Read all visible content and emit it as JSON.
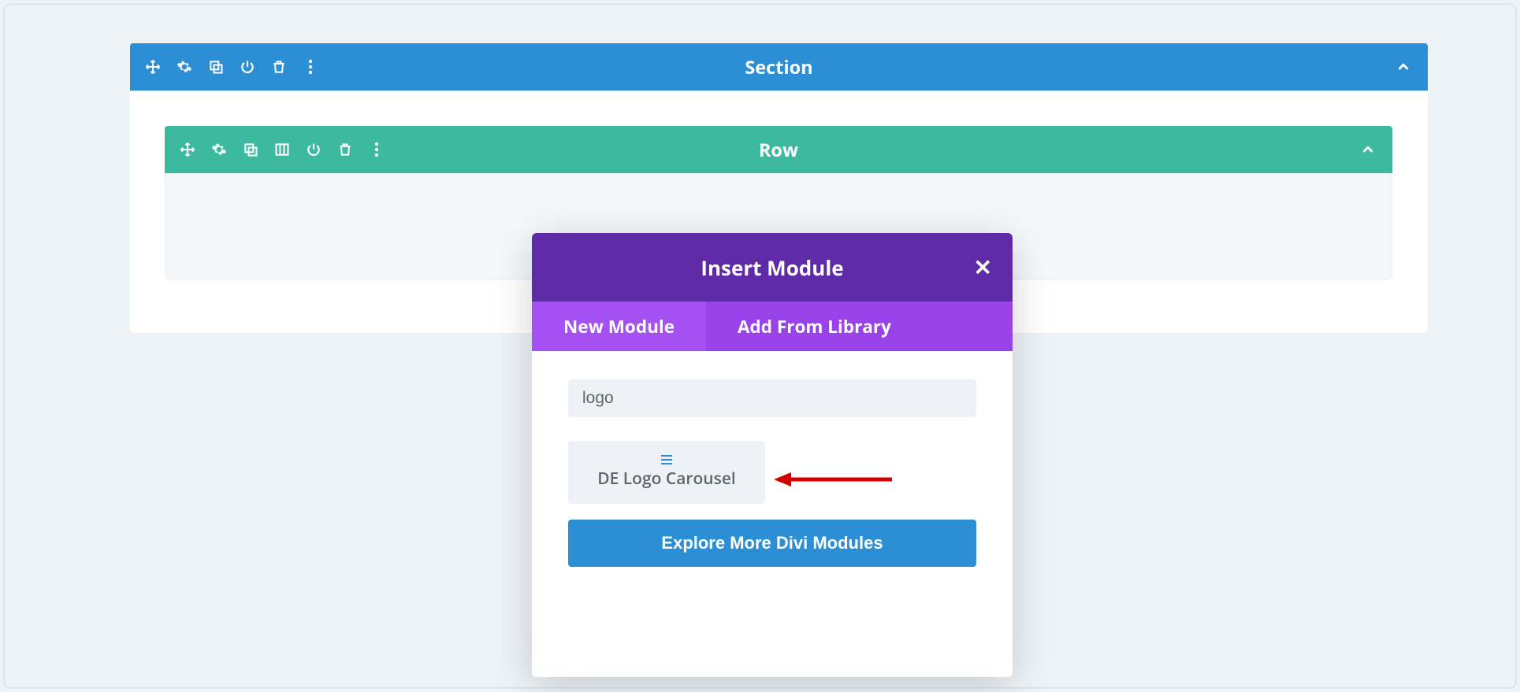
{
  "section": {
    "title": "Section"
  },
  "row": {
    "title": "Row"
  },
  "modal": {
    "title": "Insert Module",
    "tabs": {
      "new": "New Module",
      "library": "Add From Library"
    },
    "search_value": "logo",
    "module_name": "DE Logo Carousel",
    "explore_label": "Explore More Divi Modules"
  }
}
